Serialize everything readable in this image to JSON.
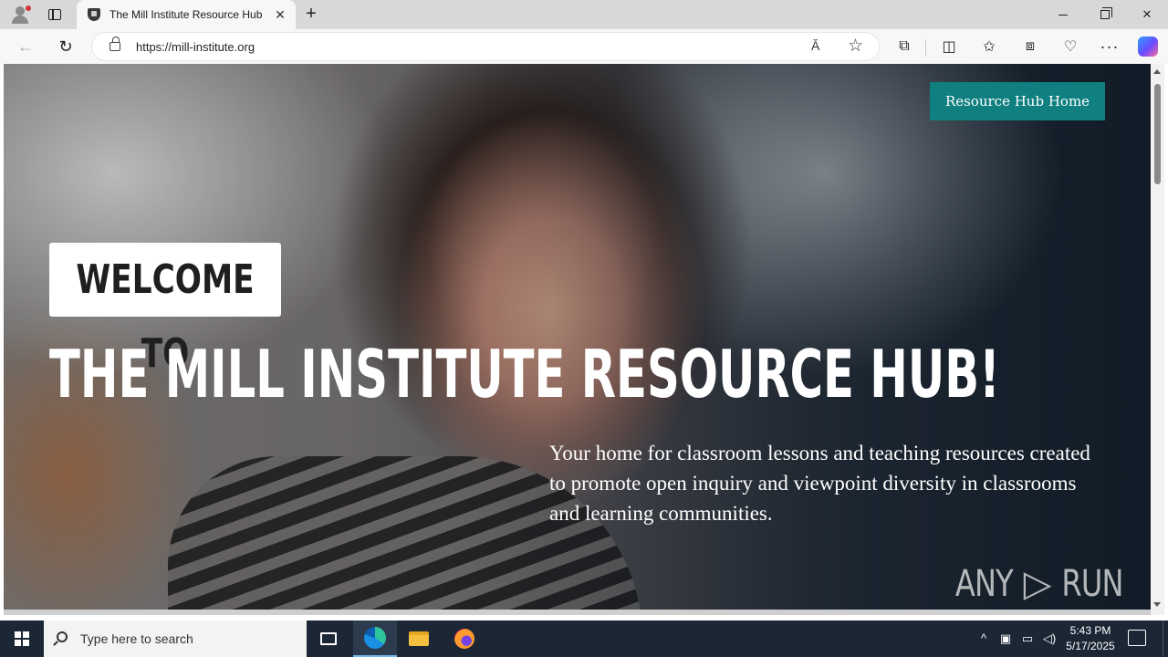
{
  "browser": {
    "tab_title": "The Mill Institute Resource Hub",
    "url": "https://mill-institute.org",
    "read_aloud_label": "Ă",
    "icons": {
      "profile": "profile-icon",
      "tab_actions": "tab-actions-icon",
      "favicon": "site-favicon-icon",
      "close_tab": "close-icon",
      "new_tab": "plus-icon",
      "back": "back-arrow-icon",
      "reload": "reload-icon",
      "lock": "lock-icon",
      "read_aloud": "read-aloud-icon",
      "favorite": "star-icon",
      "extensions": "puzzle-icon",
      "split_screen": "split-screen-icon",
      "favorites": "favorites-icon",
      "collections": "collections-icon",
      "browser_essentials": "heart-pulse-icon",
      "more": "more-icon",
      "copilot": "copilot-icon"
    }
  },
  "page": {
    "hub_home_label": "Resource Hub Home",
    "welcome": "WELCOME TO",
    "title": "THE MILL INSTITUTE RESOURCE HUB!",
    "description": "Your home for classroom lessons and teaching resources created to promote open inquiry and viewpoint diversity in classrooms and learning communities.",
    "watermark_left": "ANY",
    "watermark_right": "RUN",
    "colors": {
      "button_teal": "#0f7f80"
    }
  },
  "taskbar": {
    "search_placeholder": "Type here to search",
    "time": "5:43 PM",
    "date": "5/17/2025",
    "icons": {
      "start": "windows-start-icon",
      "search": "search-icon",
      "task_view": "task-view-icon",
      "edge": "edge-icon",
      "file_explorer": "file-explorer-icon",
      "firefox": "firefox-icon",
      "tray_overflow": "chevron-up-icon",
      "meet_now": "meet-now-icon",
      "network": "network-icon",
      "volume": "volume-icon",
      "notifications": "notification-icon"
    }
  }
}
